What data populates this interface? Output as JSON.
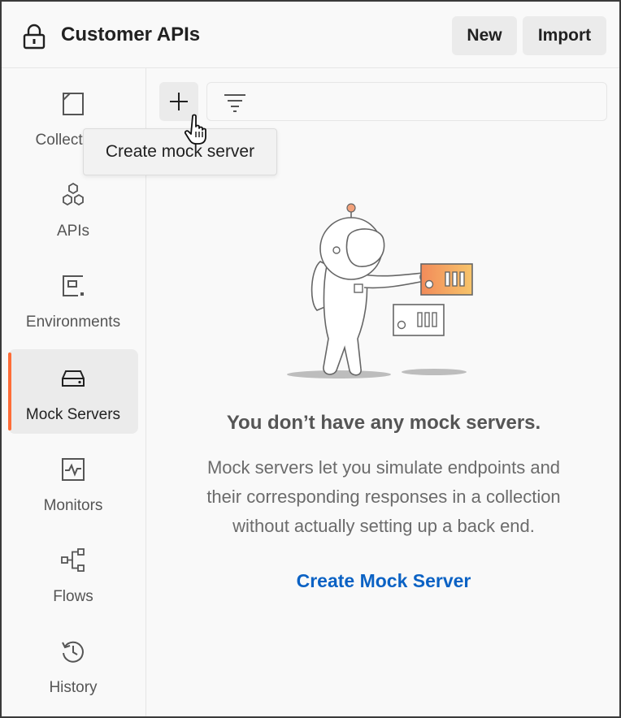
{
  "header": {
    "workspace_title": "Customer APIs",
    "new_label": "New",
    "import_label": "Import"
  },
  "sidebar": {
    "items": [
      {
        "label": "Collections",
        "icon": "collections-icon",
        "active": false
      },
      {
        "label": "APIs",
        "icon": "apis-icon",
        "active": false
      },
      {
        "label": "Environments",
        "icon": "environments-icon",
        "active": false
      },
      {
        "label": "Mock Servers",
        "icon": "mock-servers-icon",
        "active": true
      },
      {
        "label": "Monitors",
        "icon": "monitors-icon",
        "active": false
      },
      {
        "label": "Flows",
        "icon": "flows-icon",
        "active": false
      },
      {
        "label": "History",
        "icon": "history-icon",
        "active": false
      }
    ]
  },
  "toolbar": {
    "tooltip": "Create mock server"
  },
  "empty_state": {
    "title": "You don’t have any mock servers.",
    "description_lines": [
      "Mock servers let you simulate endpoints and",
      "their corresponding responses in a collection",
      "without actually setting up a back end."
    ],
    "cta": "Create Mock Server"
  },
  "colors": {
    "accent": "#ff6c37",
    "link": "#0b62c4",
    "text": "#212121",
    "muted": "#6b6b6b"
  }
}
